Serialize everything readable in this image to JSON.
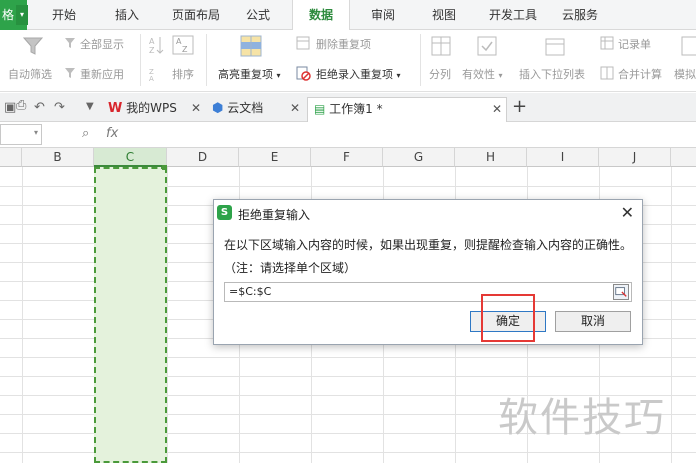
{
  "menu": {
    "logo": "格",
    "tabs": [
      "开始",
      "插入",
      "页面布局",
      "公式",
      "数据",
      "审阅",
      "视图",
      "开发工具",
      "云服务"
    ],
    "active_tab": "数据"
  },
  "ribbon": {
    "auto_filter": "自动筛选",
    "show_all": "全部显示",
    "reapply": "重新应用",
    "sort": "排序",
    "highlight_dup": "高亮重复项",
    "delete_dup": "删除重复项",
    "reject_dup": "拒绝录入重复项",
    "split": "分列",
    "validity": "有效性",
    "insert_dropdown": "插入下拉列表",
    "record_sheet": "记录单",
    "merge_calc": "合并计算",
    "simulate": "模拟"
  },
  "tabstrip": {
    "tabs": [
      {
        "label": "我的WPS"
      },
      {
        "label": "云文档"
      },
      {
        "label": "工作簿1 *"
      }
    ],
    "add": "+"
  },
  "formulabar": {
    "fx": "fx"
  },
  "grid": {
    "columns": [
      "B",
      "C",
      "D",
      "E",
      "F",
      "G",
      "H",
      "I",
      "J"
    ],
    "selected_column": "C"
  },
  "dialog": {
    "title": "拒绝重复输入",
    "description": "在以下区域输入内容的时候，如果出现重复，则提醒检查输入内容的正确性。",
    "note": "（注：请选择单个区域）",
    "range_value": "=$C:$C",
    "ok_label": "确定",
    "cancel_label": "取消"
  },
  "watermark": "软件技巧",
  "colors": {
    "accent_green": "#2ea34a",
    "selection_fill": "#e4f2dc",
    "highlight_red": "#e53935"
  }
}
